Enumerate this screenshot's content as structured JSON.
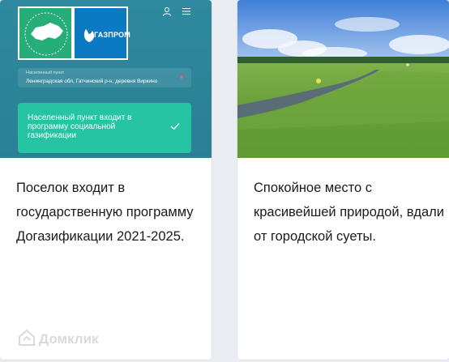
{
  "left_card": {
    "logo_gas_text": "ДОГАЗИФИКАЦИЯ РОССИИ",
    "logo_gaz_text": "ГАЗПРОМ",
    "address_label": "Населенный пункт",
    "address_value": "Ленинградская обл, Гатчинский р-н, деревня Виркино",
    "status_text": "Населенный пункт входит в программу социальной газификации",
    "caption": "Поселок входит в государственную программу Догазификации 2021-2025."
  },
  "right_card": {
    "caption": "Спокойное место с красивейшей природой, вдали от городской суеты."
  },
  "watermark": {
    "text": "Домклик"
  },
  "colors": {
    "hero_teal": "#2f8a9f",
    "logo_green": "#27ad78",
    "logo_blue": "#0b7ac2",
    "status_green": "#25c4a2"
  },
  "icons": [
    "user-icon",
    "menu-icon",
    "check-icon",
    "house-icon"
  ]
}
